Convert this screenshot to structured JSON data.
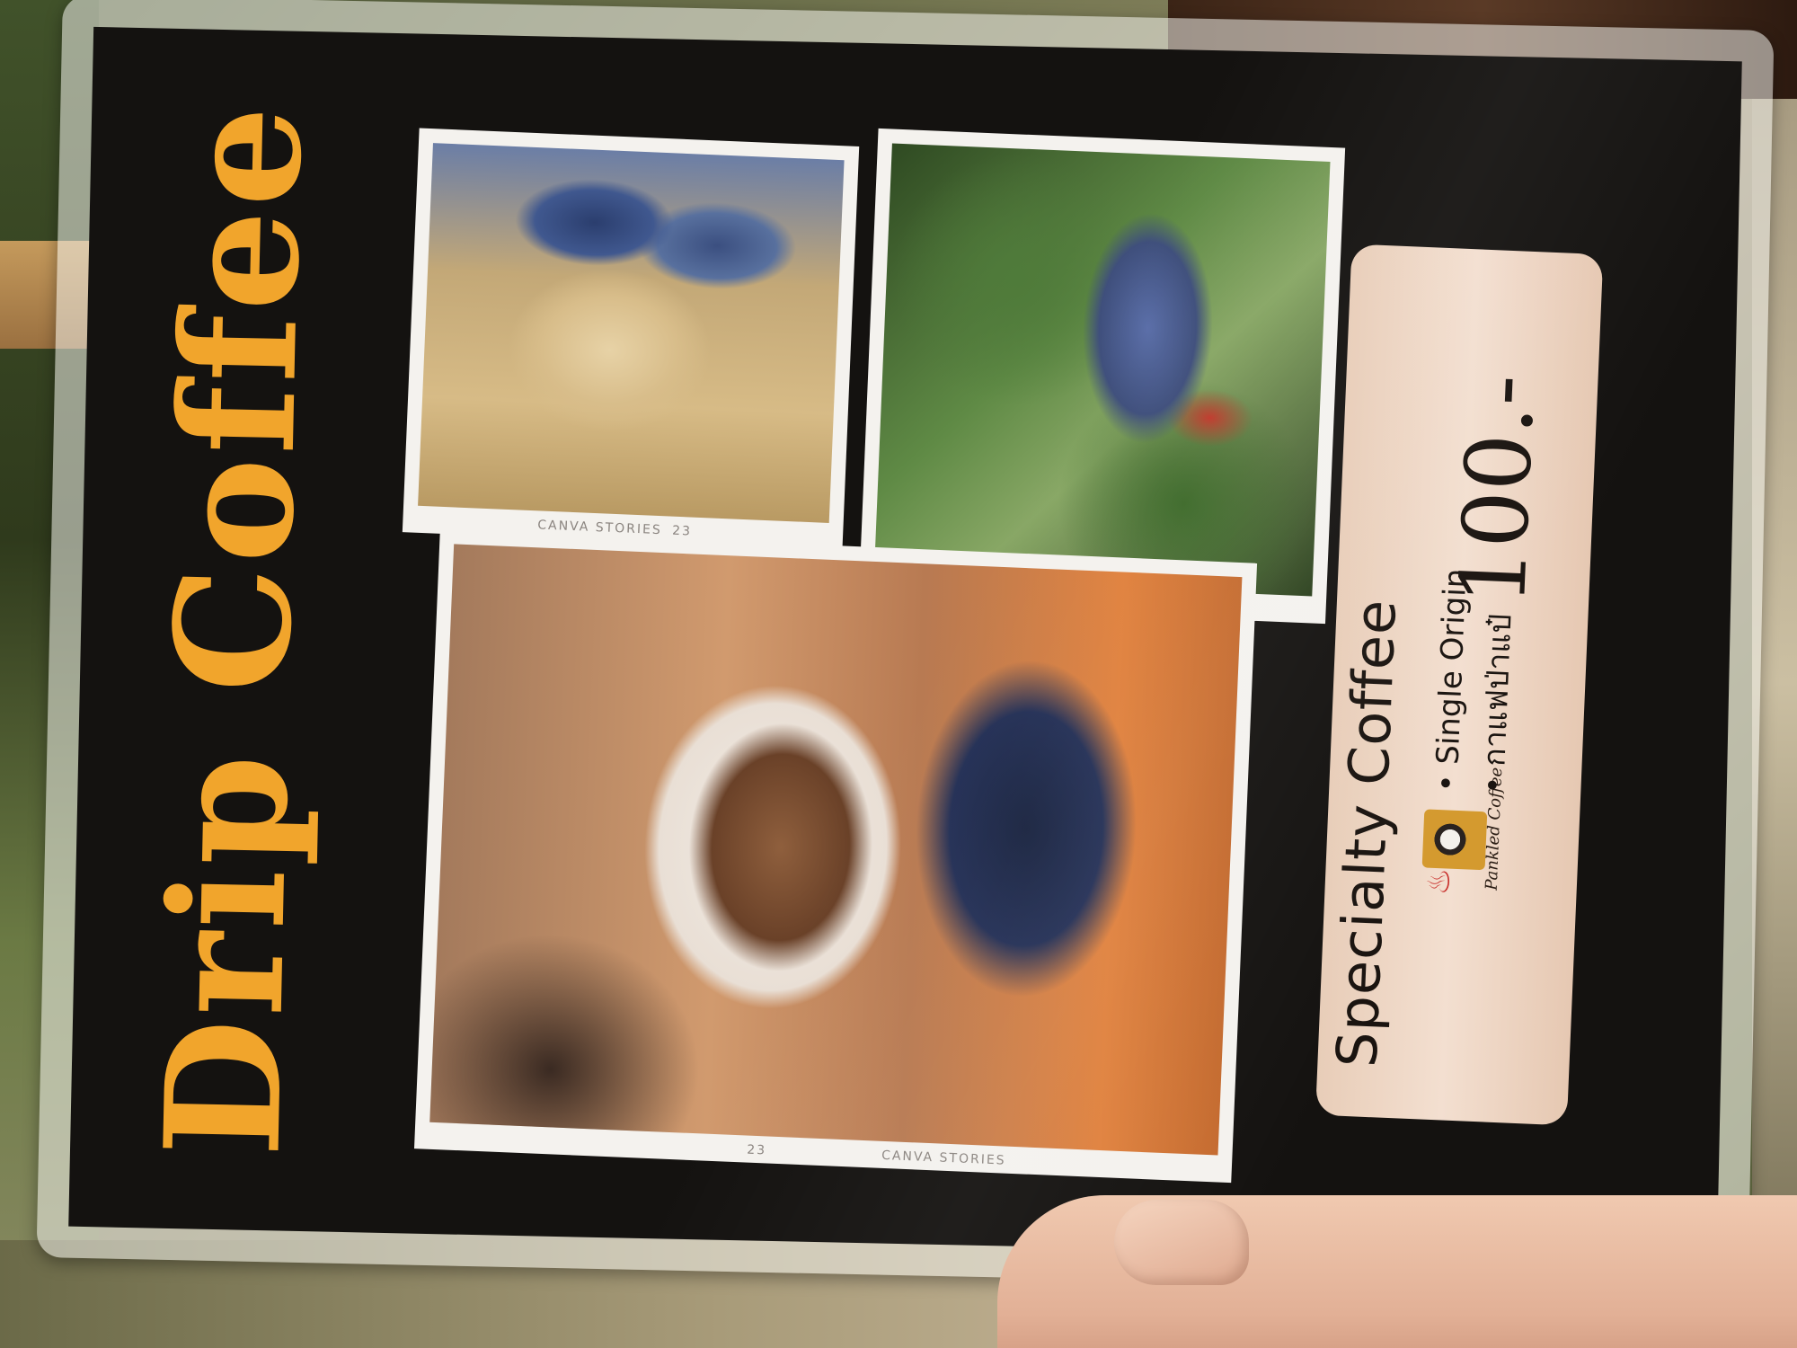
{
  "menu": {
    "title": "Drip Coffee",
    "photos": {
      "film_mark": "CANVA STORIES",
      "frame_number": "23"
    },
    "price_card": {
      "heading": "Specialty Coffee",
      "bullets": [
        "• Single Origin",
        "• กาแฟป่าแป๋"
      ],
      "price": "100.-"
    },
    "logo": {
      "brand_text": "Pankled Coffee"
    }
  },
  "colors": {
    "title": "#f1a52c",
    "card_background": "#141210",
    "price_box": "#f3dfd0"
  }
}
